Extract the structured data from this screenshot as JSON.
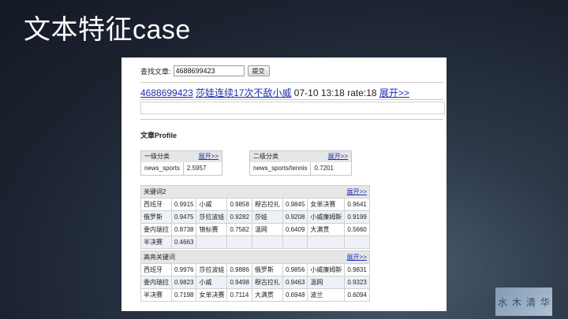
{
  "slide_title": "文本特征case",
  "search": {
    "label": "查找文章:",
    "value": "4688699423",
    "submit_label": "提交"
  },
  "article": {
    "id": "4688699423",
    "title": "莎娃连续17次不敌小威",
    "time": "07-10 13:18",
    "rate": "rate:18",
    "expand": "展开>>"
  },
  "profile_title": "文章Profile",
  "level1": {
    "header": "一级分类",
    "expand": "展开>>",
    "name": "news_sports",
    "value": "2.5957"
  },
  "level2": {
    "header": "二级分类",
    "expand": "展开>>",
    "name": "news_sports/tennis",
    "value": "0.7201"
  },
  "keywords2": {
    "header": "关键词2",
    "expand": "展开>>",
    "rows": [
      [
        [
          "西班牙",
          "0.9915"
        ],
        [
          "小威",
          "0.9858"
        ],
        [
          "穆古拉扎",
          "0.9845"
        ],
        [
          "女单决赛",
          "0.9641"
        ]
      ],
      [
        [
          "俄罗斯",
          "0.9475"
        ],
        [
          "莎拉波娃",
          "0.9282"
        ],
        [
          "莎娃",
          "0.9208"
        ],
        [
          "小威廉姆斯",
          "0.9199"
        ]
      ],
      [
        [
          "委内瑞拉",
          "0.8738"
        ],
        [
          "锦标赛",
          "0.7582"
        ],
        [
          "温网",
          "0.6409"
        ],
        [
          "大满贯",
          "0.5660"
        ]
      ],
      [
        [
          "半决赛",
          "0.4663"
        ]
      ]
    ]
  },
  "highlight_keywords": {
    "header": "高亮关键词",
    "expand": "展开>>",
    "rows": [
      [
        [
          "西班牙",
          "0.9976"
        ],
        [
          "莎拉波娃",
          "0.9886"
        ],
        [
          "俄罗斯",
          "0.9856"
        ],
        [
          "小威廉姆斯",
          "0.9831"
        ]
      ],
      [
        [
          "委内瑞拉",
          "0.9823"
        ],
        [
          "小威",
          "0.9498"
        ],
        [
          "穆古拉扎",
          "0.9463"
        ],
        [
          "温网",
          "0.9323"
        ]
      ],
      [
        [
          "半决赛",
          "0.7198"
        ],
        [
          "女单决赛",
          "0.7114"
        ],
        [
          "大满贯",
          "0.6948"
        ],
        [
          "波兰",
          "0.6094"
        ]
      ]
    ]
  },
  "watermark": [
    "水",
    "木",
    "清",
    "华"
  ]
}
